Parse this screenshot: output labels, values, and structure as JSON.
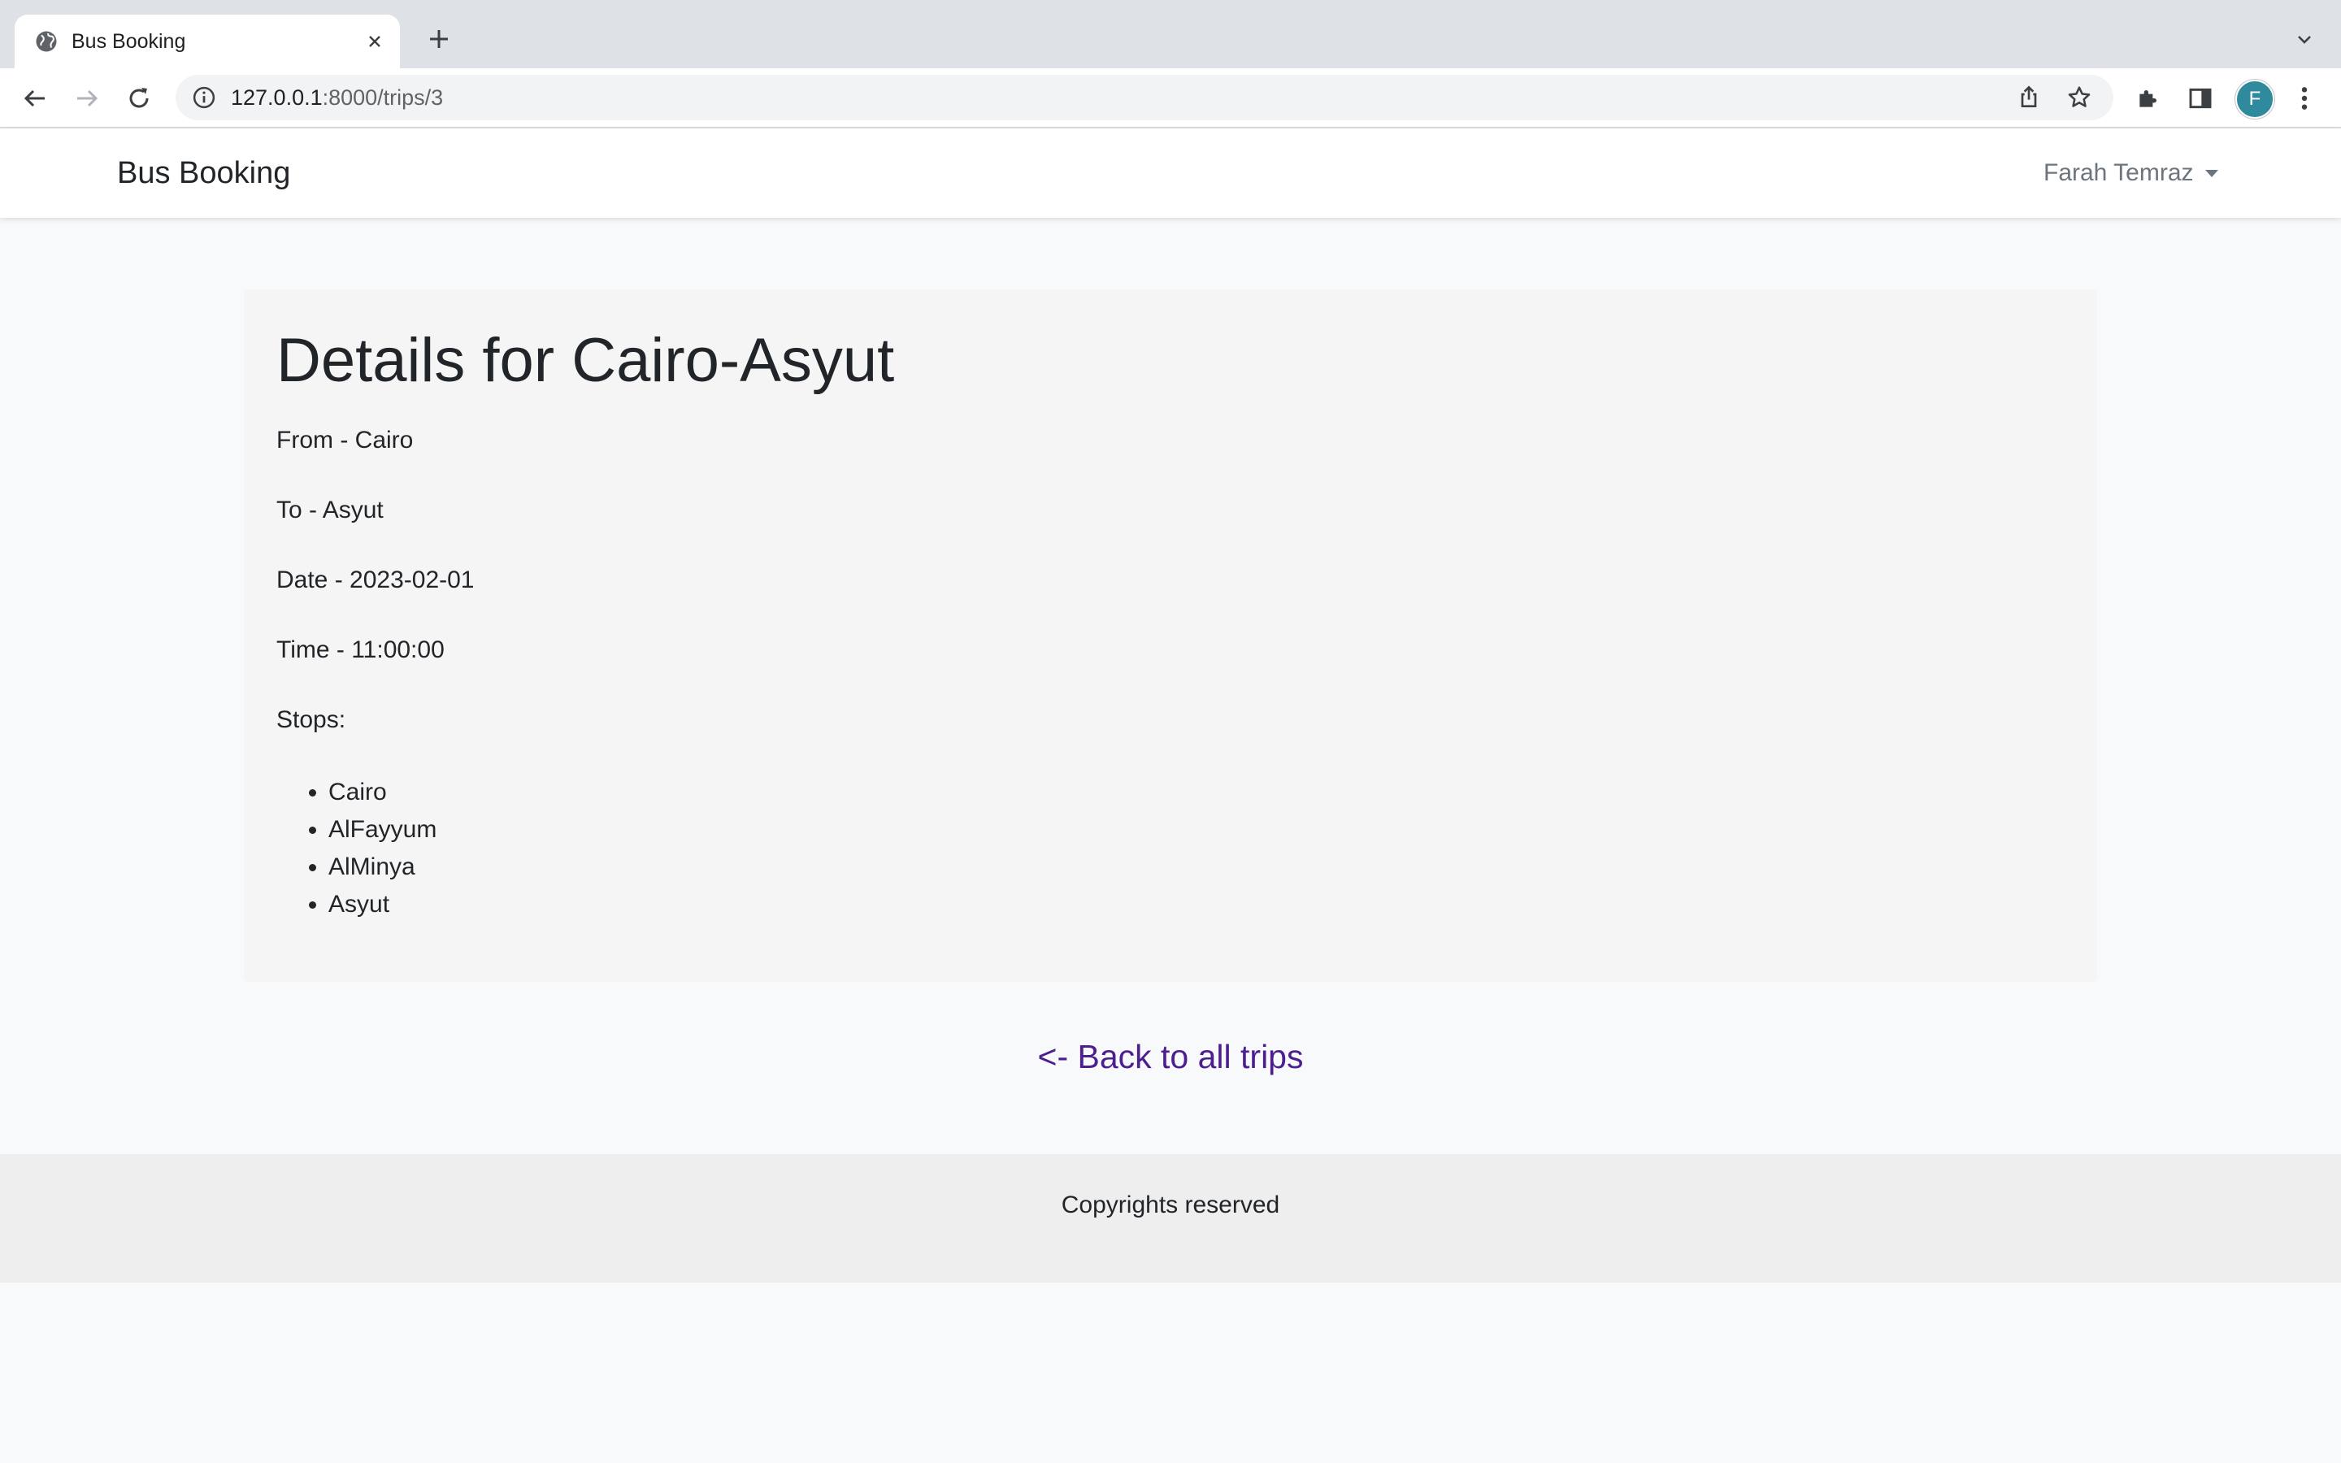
{
  "browser": {
    "tab": {
      "title": "Bus Booking",
      "favicon": "globe-icon"
    },
    "address": {
      "host": "127.0.0.1",
      "rest": ":8000/trips/3"
    },
    "profile_initial": "F"
  },
  "navbar": {
    "brand": "Bus Booking",
    "user_name": "Farah Temraz"
  },
  "trip": {
    "title": "Details for Cairo-Asyut",
    "from": "From - Cairo",
    "to": "To - Asyut",
    "date": "Date - 2023-02-01",
    "time": "Time - 11:00:00",
    "stops_label": "Stops:",
    "stops": [
      "Cairo",
      "AlFayyum",
      "AlMinya",
      "Asyut"
    ]
  },
  "back_link": "<- Back to all trips",
  "footer": {
    "text": "Copyrights reserved"
  },
  "colors": {
    "link": "#4c1e8f",
    "avatar": "#2f8a9e",
    "page_bg": "#f8f9fa",
    "card_bg": "#f5f5f5"
  }
}
